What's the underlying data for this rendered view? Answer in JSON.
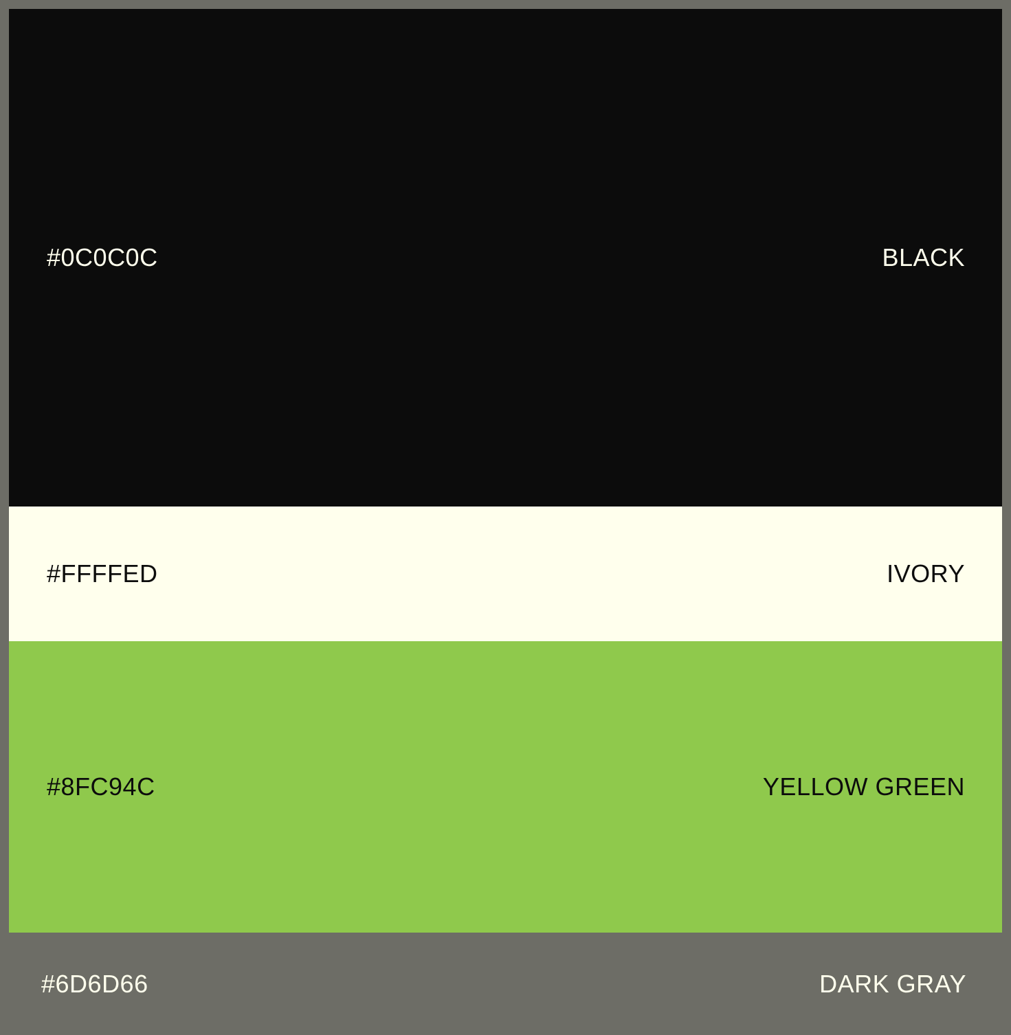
{
  "swatches": [
    {
      "hex": "#0C0C0C",
      "name": "BLACK",
      "background": "#0c0c0c",
      "text_color": "#ffffed"
    },
    {
      "hex": "#FFFFED",
      "name": "IVORY",
      "background": "#ffffed",
      "text_color": "#0c0c0c"
    },
    {
      "hex": "#8FC94C",
      "name": "YELLOW GREEN",
      "background": "#8fc94c",
      "text_color": "#0c0c0c"
    }
  ],
  "base": {
    "hex": "#6D6D66",
    "name": "DARK GRAY",
    "background": "#6d6d66",
    "text_color": "#ffffed"
  }
}
